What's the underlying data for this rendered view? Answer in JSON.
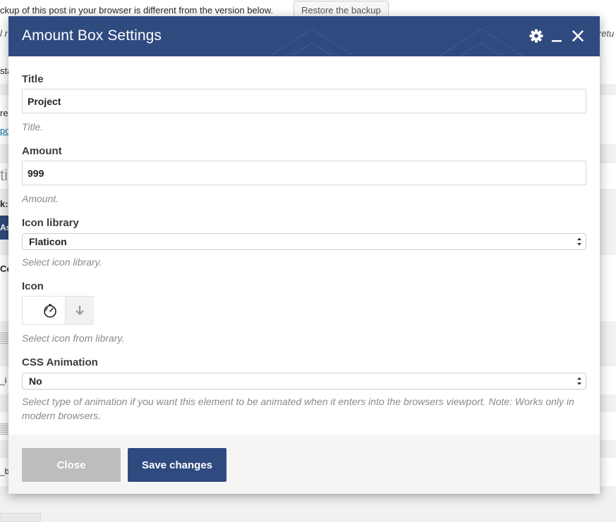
{
  "background": {
    "notice_text": "ckup of this post in your browser is different from the version below.",
    "restore_button": "Restore the backup",
    "fragments": {
      "f1": "l r",
      "f2": "retu",
      "f3": "sta",
      "f4": "re",
      "f5": "po",
      "f6": "ti",
      "f7": "k:",
      "f8": "As",
      "f9": "Co",
      "f10": "_i",
      "f11": "_b"
    }
  },
  "modal": {
    "title": "Amount Box Settings",
    "header_icons": [
      "gear-icon",
      "minimize-icon",
      "close-icon"
    ],
    "fields": {
      "title": {
        "label": "Title",
        "value": "Project",
        "help": "Title."
      },
      "amount": {
        "label": "Amount",
        "value": "999",
        "help": "Amount."
      },
      "icon_library": {
        "label": "Icon library",
        "selected": "Flaticon",
        "help": "Select icon library."
      },
      "icon": {
        "label": "Icon",
        "selected_icon": "stopwatch-icon",
        "help": "Select icon from library."
      },
      "css_animation": {
        "label": "CSS Animation",
        "selected": "No",
        "help": "Select type of animation if you want this element to be animated when it enters into the browsers viewport. Note: Works only in modern browsers."
      }
    },
    "footer": {
      "close_label": "Close",
      "save_label": "Save changes"
    }
  },
  "colors": {
    "header_bg": "#2f4a7f",
    "save_bg": "#2f4a7f",
    "close_bg": "#bdbdbd"
  }
}
